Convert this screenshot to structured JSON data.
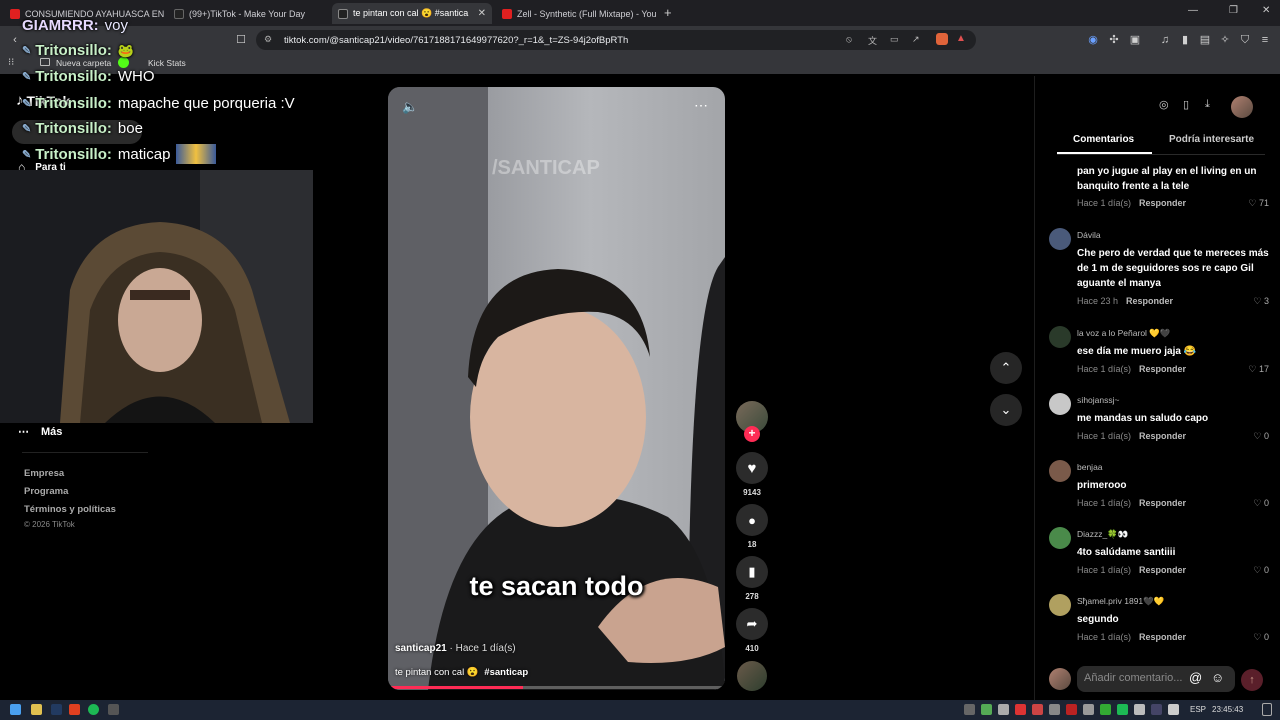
{
  "browser": {
    "tabs": [
      {
        "label": "CONSUMIENDO AYAHUASCA EN EL",
        "icon": "youtube-icon",
        "color": "#e02020"
      },
      {
        "label": "(99+)TikTok - Make Your Day",
        "icon": "tiktok-icon",
        "color": "#ffffff"
      },
      {
        "label": "te pintan con cal 😮 #santica",
        "icon": "tiktok-icon",
        "color": "#ffffff"
      },
      {
        "label": "Zell - Synthetic (Full Mixtape) - YouTu",
        "icon": "youtube-icon",
        "color": "#e02020"
      }
    ],
    "url": "tiktok.com/@santicap21/video/7617188171649977620?_r=1&_t=ZS-94j2ofBpRTh",
    "bookmarks": [
      {
        "label": "Nueva carpeta"
      },
      {
        "label": "Kick Stats"
      }
    ]
  },
  "overlay_chat": [
    {
      "user": "GIAMRRR:",
      "message": "voy"
    },
    {
      "user": "Tritonsillo:",
      "message": ""
    },
    {
      "user": "Tritonsillo:",
      "message": "WHO"
    },
    {
      "user": "Tritonsillo:",
      "message": "mapache que porqueria :V"
    },
    {
      "user": "Tritonsillo:",
      "message": "boe"
    },
    {
      "user": "Tritonsillo:",
      "message": "maticap"
    }
  ],
  "tiktok": {
    "logo": "TikTok",
    "nav_para_ti": "Para ti",
    "more_label": "Más",
    "footer_links": [
      "Empresa",
      "Programa",
      "Términos y políticas"
    ],
    "copyright": "© 2026 TikTok"
  },
  "video": {
    "watermark": "/SANTICAP",
    "caption_overlay": "te sacan todo",
    "author": "santicap21",
    "time": "· Hace 1 día(s)",
    "description": "te pintan con cal 😮",
    "hashtag": "#santicap",
    "progress": 0.4
  },
  "actions": {
    "likes": "9143",
    "comments": "18",
    "saves": "278",
    "shares": "410"
  },
  "comments_panel": {
    "tab_comments": "Comentarios",
    "tab_suggested": "Podría interesarte",
    "reply_label": "Responder",
    "input_placeholder": "Añadir comentario...",
    "items": [
      {
        "author": "",
        "text": "pan yo jugue al play en el living en un banquito frente a la tele",
        "time": "Hace 1 día(s)",
        "likes": "71",
        "color": "#555"
      },
      {
        "author": "Dávila",
        "text": "Che pero de verdad que te mereces más de 1 m de seguidores sos re capo Gil aguante el manya",
        "time": "Hace 23 h",
        "likes": "3",
        "color": "#4a5a7a"
      },
      {
        "author": "la voz a lo Peñarol 💛🖤",
        "text": "ese día me muero jaja 😂",
        "time": "Hace 1 día(s)",
        "likes": "17",
        "color": "#2a3a2a"
      },
      {
        "author": "ꜱihojanssj~",
        "text": "me mandas un saludo capo",
        "time": "Hace 1 día(s)",
        "likes": "0",
        "color": "#c8c8c8"
      },
      {
        "author": "benjaa",
        "text": "primerooo",
        "time": "Hace 1 día(s)",
        "likes": "0",
        "color": "#7a5a4a"
      },
      {
        "author": "Diazzz_🍀👀",
        "text": "4to salúdame santiiii",
        "time": "Hace 1 día(s)",
        "likes": "0",
        "color": "#4a8a4a"
      },
      {
        "author": "Sђamel.priv 1891🖤💛",
        "text": "segundo",
        "time": "Hace 1 día(s)",
        "likes": "0",
        "color": "#b0a060"
      }
    ]
  },
  "taskbar": {
    "lang": "ESP",
    "clock": "23:45:43"
  }
}
